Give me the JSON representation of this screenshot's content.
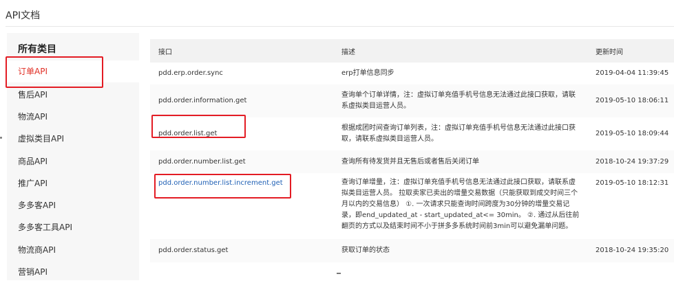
{
  "page": {
    "title": "API文档"
  },
  "sidebar": {
    "heading": "所有类目",
    "items": [
      {
        "label": "订单API",
        "active": true
      },
      {
        "label": "售后API"
      },
      {
        "label": "物流API"
      },
      {
        "label": "虚拟类目API"
      },
      {
        "label": "商品API"
      },
      {
        "label": "推广API"
      },
      {
        "label": "多多客API"
      },
      {
        "label": "多多客工具API"
      },
      {
        "label": "物流商API"
      },
      {
        "label": "营销API"
      }
    ]
  },
  "table": {
    "headers": [
      "接口",
      "描述",
      "更新时间"
    ],
    "rows": [
      {
        "api": "pdd.erp.order.sync",
        "desc": "erp打单信息同步",
        "time": "2019-04-04 11:39:45"
      },
      {
        "api": "pdd.order.information.get",
        "desc": "查询单个订单详情，注：虚拟订单充值手机号信息无法通过此接口获取，请联系虚拟类目运营人员。",
        "time": "2019-05-10 18:06:11"
      },
      {
        "api": "pdd.order.list.get",
        "desc": "根据成团时间查询订单列表，注：虚拟订单充值手机号信息无法通过此接口获取，请联系虚拟类目运营人员。",
        "time": "2019-05-10 18:09:44"
      },
      {
        "api": "pdd.order.number.list.get",
        "desc": "查询所有待发货并且无售后或者售后关闭订单",
        "time": "2018-10-24 19:37:29"
      },
      {
        "api": "pdd.order.number.list.increment.get",
        "desc": "查询订单增量，注：虚拟订单充值手机号信息无法通过此接口获取，请联系虚拟类目运营人员。 拉取卖家已卖出的增量交易数据（只能获取到成交时间三个月以内的交易信息） ①. 一次请求只能查询时间跨度为30分钟的增量交易记录，即end_updated_at - start_updated_at<= 30min。 ②. 通过从后往前翻页的方式以及结束时间不小于拼多多系统时间前3min可以避免漏单问题。",
        "time": "2019-05-10 18:12:31",
        "link": true
      },
      {
        "api": "pdd.order.status.get",
        "desc": "获取订单的状态",
        "time": "2018-10-24 19:35:20"
      }
    ]
  }
}
